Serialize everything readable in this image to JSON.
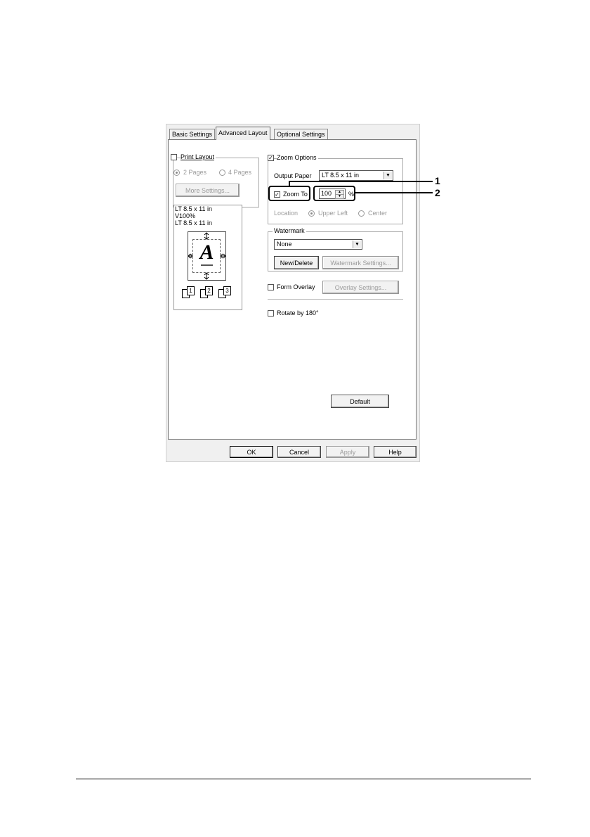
{
  "tabs": [
    {
      "label": "Basic Settings",
      "active": false
    },
    {
      "label": "Advanced Layout",
      "active": true
    },
    {
      "label": "Optional Settings",
      "active": false
    }
  ],
  "print_layout": {
    "label": "Print Layout",
    "checked": false,
    "radio_2pages": "2 Pages",
    "radio_4pages": "4 Pages",
    "more_settings": "More Settings..."
  },
  "preview": {
    "line1": "LT 8.5 x 11 in",
    "line2": "V100%",
    "line3": "LT 8.5 x 11 in",
    "letter": "A",
    "page_numbers": [
      "1",
      "2",
      "3"
    ]
  },
  "zoom_options": {
    "label": "Zoom Options",
    "checked": true,
    "output_paper_label": "Output Paper",
    "output_paper_value": "LT 8.5 x 11 in",
    "zoom_to_label": "Zoom To",
    "zoom_to_checked": true,
    "zoom_value": "100",
    "percent": "%",
    "location_label": "Location",
    "upper_left": "Upper Left",
    "center": "Center"
  },
  "watermark": {
    "label": "Watermark",
    "value": "None",
    "new_delete": "New/Delete",
    "settings": "Watermark Settings..."
  },
  "form_overlay": {
    "label": "Form Overlay",
    "checked": false,
    "settings": "Overlay Settings..."
  },
  "rotate": {
    "label": "Rotate by 180°",
    "checked": false
  },
  "default_button": "Default",
  "footer": {
    "ok": "OK",
    "cancel": "Cancel",
    "apply": "Apply",
    "help": "Help"
  },
  "callouts": {
    "one": "1",
    "two": "2"
  }
}
